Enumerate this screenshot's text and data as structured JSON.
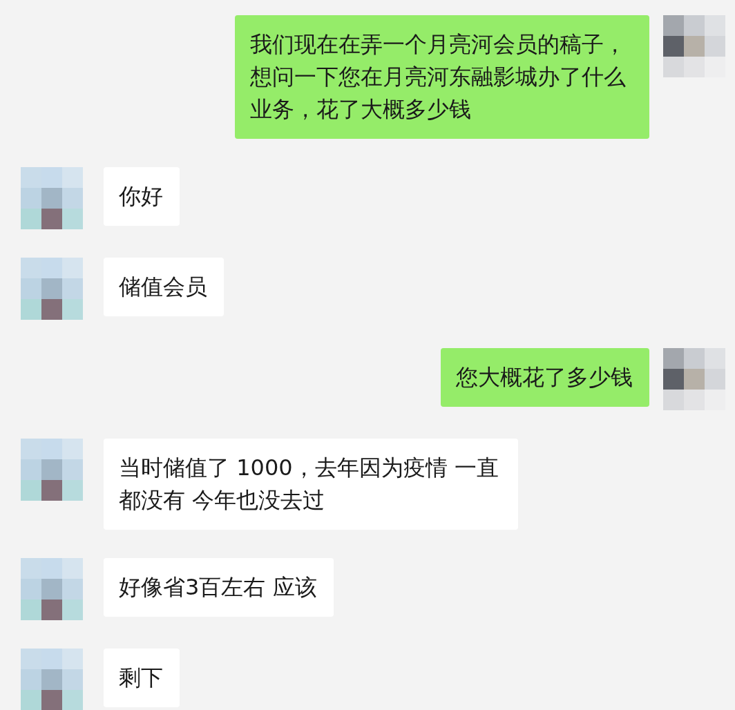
{
  "messages": [
    {
      "kind": "sent",
      "text": "我们现在在弄一个月亮河会员的稿子，想问一下您在月亮河东融影城办了什么业务，花了大概多少钱"
    },
    {
      "kind": "received",
      "text": "你好"
    },
    {
      "kind": "received",
      "text": "储值会员"
    },
    {
      "kind": "sent",
      "text": "您大概花了多少钱"
    },
    {
      "kind": "received",
      "text": "当时储值了 1000，去年因为疫情 一直都没有 今年也没去过"
    },
    {
      "kind": "received",
      "text": "好像省3百左右 应该"
    },
    {
      "kind": "received",
      "text": "剩下"
    }
  ]
}
